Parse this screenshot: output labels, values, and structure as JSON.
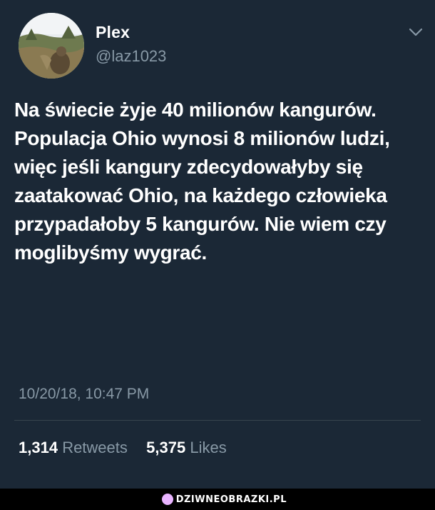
{
  "tweet": {
    "display_name": "Plex",
    "handle": "@laz1023",
    "text": "Na świecie żyje 40 milionów kangurów. Populacja Ohio wynosi 8 milionów ludzi, więc jeśli kangury zdecydowałyby się zaatakować Ohio, na każdego człowieka przypadałoby 5 kangurów. Nie wiem czy moglibyśmy wygrać.",
    "timestamp": "10/20/18, 10:47 PM",
    "retweets_count": "1,314",
    "retweets_label": "Retweets",
    "likes_count": "5,375",
    "likes_label": "Likes",
    "menu_icon": "chevron-down-icon",
    "avatar_icon": "avatar"
  },
  "watermark": {
    "text": "DZIWNEOBRAZKI.PL"
  },
  "colors": {
    "background": "#1b2836",
    "secondary_text": "#8899a6",
    "primary_text": "#ffffff",
    "divider": "#38444d"
  }
}
